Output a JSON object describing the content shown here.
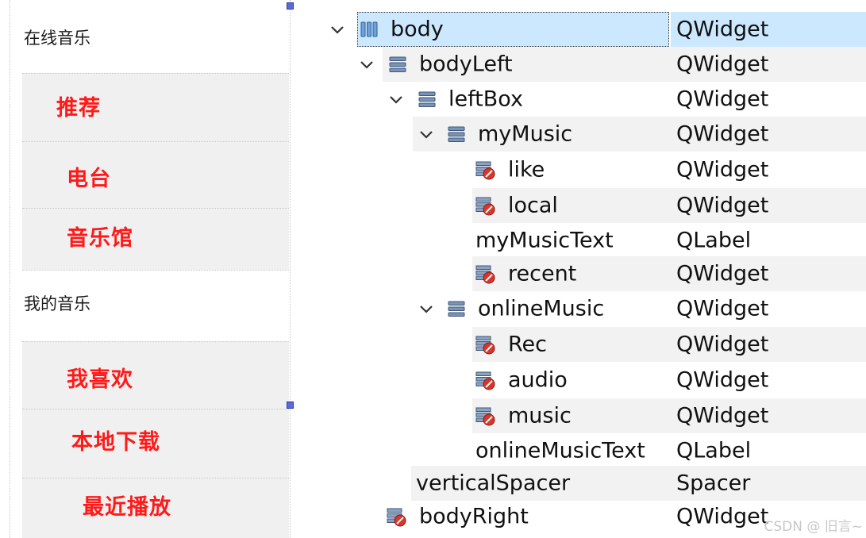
{
  "form_preview": {
    "online_section": "在线音乐",
    "my_section": "我的音乐",
    "buttons": {
      "recommend": "推荐",
      "radio": "电台",
      "music_hall": "音乐馆",
      "like": "我喜欢",
      "local": "本地下载",
      "recent": "最近播放"
    }
  },
  "object_tree": {
    "rows": [
      {
        "name": "body",
        "class": "QWidget"
      },
      {
        "name": "bodyLeft",
        "class": "QWidget"
      },
      {
        "name": "leftBox",
        "class": "QWidget"
      },
      {
        "name": "myMusic",
        "class": "QWidget"
      },
      {
        "name": "like",
        "class": "QWidget"
      },
      {
        "name": "local",
        "class": "QWidget"
      },
      {
        "name": "myMusicText",
        "class": "QLabel"
      },
      {
        "name": "recent",
        "class": "QWidget"
      },
      {
        "name": "onlineMusic",
        "class": "QWidget"
      },
      {
        "name": "Rec",
        "class": "QWidget"
      },
      {
        "name": "audio",
        "class": "QWidget"
      },
      {
        "name": "music",
        "class": "QWidget"
      },
      {
        "name": "onlineMusicText",
        "class": "QLabel"
      },
      {
        "name": "verticalSpacer",
        "class": "Spacer"
      },
      {
        "name": "bodyRight",
        "class": "QWidget"
      }
    ]
  },
  "watermark": "CSDN @ 旧言~",
  "colors": {
    "button_text": "#ff1a1a",
    "selection": "#cce8ff",
    "alt_row": "#f2f2f2",
    "panel": "#f0f0f0"
  }
}
